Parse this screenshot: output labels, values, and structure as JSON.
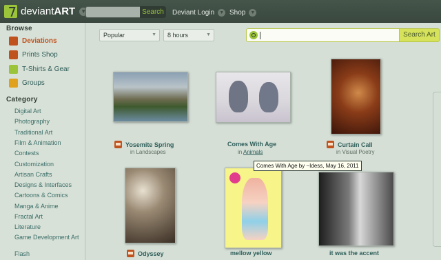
{
  "header": {
    "logo_light": "deviant",
    "logo_bold": "ART",
    "search_button": "Search",
    "login_link": "Deviant Login",
    "shop_link": "Shop",
    "caret_glyph": "▼"
  },
  "sidebar": {
    "browse_heading": "Browse",
    "browse_items": [
      {
        "label": "Deviations",
        "icon": "deviations-icon",
        "color": "#c0521e"
      },
      {
        "label": "Prints Shop",
        "icon": "prints-icon",
        "color": "#c0521e"
      },
      {
        "label": "T-Shirts & Gear",
        "icon": "tshirt-icon",
        "color": "#9bc43a"
      },
      {
        "label": "Groups",
        "icon": "groups-icon",
        "color": "#e0a21e"
      }
    ],
    "category_heading": "Category",
    "categories": [
      "Digital Art",
      "Photography",
      "Traditional Art",
      "Film & Animation",
      "Contests",
      "Customization",
      "Artisan Crafts",
      "Designs & Interfaces",
      "Cartoons & Comics",
      "Manga & Anime",
      "Fractal Art",
      "Literature",
      "Game Development Art",
      "Flash"
    ]
  },
  "filters": {
    "sort_value": "Popular",
    "time_value": "8 hours",
    "search_value": "",
    "search_button": "Search Art",
    "caret_glyph": "▼"
  },
  "deviations": [
    {
      "title": "Yosemite Spring",
      "in_prefix": "in",
      "category": "Landscapes",
      "has_icon": true
    },
    {
      "title": "Comes With Age",
      "in_prefix": "in",
      "category": "Animals",
      "has_icon": false
    },
    {
      "title": "Curtain Call",
      "in_prefix": "in",
      "category": "Visual Poetry",
      "has_icon": true
    },
    {
      "title": "Odyssey",
      "in_prefix": "",
      "category": "",
      "has_icon": true
    },
    {
      "title": "mellow yellow",
      "in_prefix": "",
      "category": "",
      "has_icon": false
    },
    {
      "title": "it was the accent",
      "in_prefix": "",
      "category": "",
      "has_icon": false
    }
  ],
  "tooltip": "Comes With Age by ~Idess, May 16, 2011",
  "colors": {
    "accent_green": "#9bc43a",
    "topbar": "#3a483f",
    "link": "#2f5e5a",
    "active": "#c0521e"
  }
}
